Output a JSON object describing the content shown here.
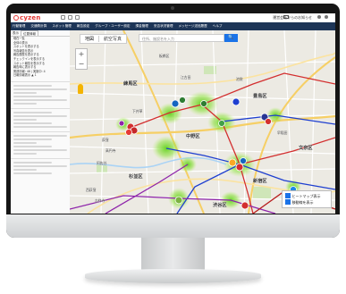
{
  "app": {
    "logo_text": "cyzen",
    "notice": "運営会社からのお知らせ"
  },
  "menu": {
    "items": [
      "行動管理",
      "交通費計算",
      "スポット管理",
      "報告設定",
      "グループ・ユーザー設定",
      "課金管理",
      "安否状況管理",
      "メッセージ送信履歴",
      "ヘルプ"
    ]
  },
  "sidebar": {
    "tabs": [
      "表示",
      "位置情報"
    ],
    "items": [
      "現在一覧",
      "全体の表示",
      "スポットを表示する",
      "写真報告を表示",
      "報告履歴を表示する",
      "チェックインを表示する",
      "スポット報告を表示する",
      "報告時に表示する",
      "関連情報: 48 | 実施中: 4",
      "日報情報表示 ▲ 1"
    ]
  },
  "map": {
    "tabs": [
      "地図",
      "航空写真"
    ],
    "search_placeholder": "住所、施設名を入力",
    "search_button": "🔍",
    "zoom_in": "+",
    "zoom_out": "−",
    "places": [
      "練馬区",
      "中野区",
      "杉並区",
      "新宿区",
      "文京区",
      "豊島区",
      "渋谷区"
    ],
    "minor_places": [
      "板橋区",
      "高円寺",
      "阿佐谷",
      "荻窪",
      "早稲田",
      "池袋",
      "吉祥寺",
      "西荻窪",
      "江古田",
      "下井草"
    ]
  },
  "legend": {
    "heatmap_label": "ヒートマップ表示",
    "route_label": "移動線を表示",
    "heatmap_on": true,
    "route_on": true
  },
  "colors": {
    "menubar": "#1d3557",
    "heat": "#7cd42e",
    "route_red": "#d32f2f",
    "route_blue": "#1e3fd0",
    "route_purple": "#8e24aa"
  }
}
